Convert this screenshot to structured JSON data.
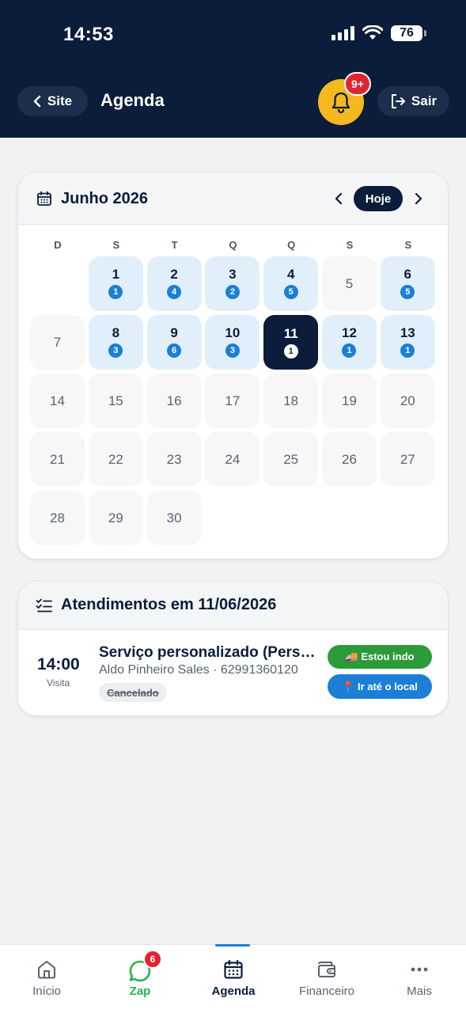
{
  "status_bar": {
    "time": "14:53",
    "battery": "76"
  },
  "header": {
    "back_label": "Site",
    "title": "Agenda",
    "notification_badge": "9+",
    "logout_label": "Sair"
  },
  "calendar": {
    "month_label": "Junho 2026",
    "today_label": "Hoje",
    "weekdays": [
      "D",
      "S",
      "T",
      "Q",
      "Q",
      "S",
      "S"
    ],
    "days": [
      {
        "num": "",
        "count": null
      },
      {
        "num": "1",
        "count": "1"
      },
      {
        "num": "2",
        "count": "4"
      },
      {
        "num": "3",
        "count": "2"
      },
      {
        "num": "4",
        "count": "5"
      },
      {
        "num": "5",
        "count": null
      },
      {
        "num": "6",
        "count": "5"
      },
      {
        "num": "7",
        "count": null
      },
      {
        "num": "8",
        "count": "3"
      },
      {
        "num": "9",
        "count": "6"
      },
      {
        "num": "10",
        "count": "3"
      },
      {
        "num": "11",
        "count": "1",
        "selected": true
      },
      {
        "num": "12",
        "count": "1"
      },
      {
        "num": "13",
        "count": "1"
      },
      {
        "num": "14",
        "count": null
      },
      {
        "num": "15",
        "count": null
      },
      {
        "num": "16",
        "count": null
      },
      {
        "num": "17",
        "count": null
      },
      {
        "num": "18",
        "count": null
      },
      {
        "num": "19",
        "count": null
      },
      {
        "num": "20",
        "count": null
      },
      {
        "num": "21",
        "count": null
      },
      {
        "num": "22",
        "count": null
      },
      {
        "num": "23",
        "count": null
      },
      {
        "num": "24",
        "count": null
      },
      {
        "num": "25",
        "count": null
      },
      {
        "num": "26",
        "count": null
      },
      {
        "num": "27",
        "count": null
      },
      {
        "num": "28",
        "count": null
      },
      {
        "num": "29",
        "count": null
      },
      {
        "num": "30",
        "count": null
      }
    ]
  },
  "appointments": {
    "title": "Atendimentos em 11/06/2026",
    "items": [
      {
        "time": "14:00",
        "kind": "Visita",
        "service": "Serviço personalizado (Personalizado)",
        "client": "Aldo Pinheiro Sales · 62991360120",
        "status": "Cancelado",
        "going_label": "🚚 Estou indo",
        "location_label": "📍 Ir até o local"
      }
    ]
  },
  "bottom_nav": {
    "items": [
      {
        "label": "Início",
        "icon": "home-icon"
      },
      {
        "label": "Zap",
        "icon": "whatsapp-icon",
        "badge": "6"
      },
      {
        "label": "Agenda",
        "icon": "calendar-icon",
        "active": true
      },
      {
        "label": "Financeiro",
        "icon": "wallet-icon"
      },
      {
        "label": "Mais",
        "icon": "more-icon"
      }
    ]
  },
  "colors": {
    "navy": "#0b1d3a",
    "accent_yellow": "#f5b81f",
    "badge_red": "#e0242f",
    "event_blue": "#1b7fd6",
    "event_bg": "#e1effb",
    "green": "#2b9b3a"
  }
}
